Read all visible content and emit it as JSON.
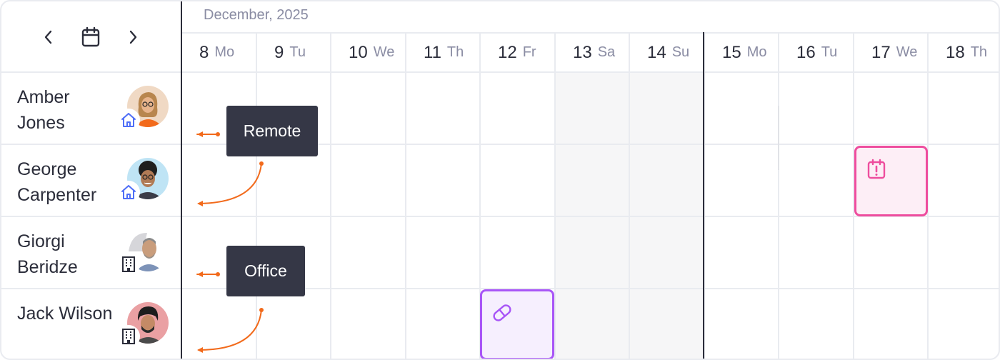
{
  "calendar": {
    "month_label": "December, 2025",
    "days": [
      {
        "num": "8",
        "wd": "Mo",
        "weekend": false
      },
      {
        "num": "9",
        "wd": "Tu",
        "weekend": false
      },
      {
        "num": "10",
        "wd": "We",
        "weekend": false
      },
      {
        "num": "11",
        "wd": "Th",
        "weekend": false
      },
      {
        "num": "12",
        "wd": "Fr",
        "weekend": false
      },
      {
        "num": "13",
        "wd": "Sa",
        "weekend": true
      },
      {
        "num": "14",
        "wd": "Su",
        "weekend": true
      },
      {
        "num": "15",
        "wd": "Mo",
        "weekend": false
      },
      {
        "num": "16",
        "wd": "Tu",
        "weekend": false
      },
      {
        "num": "17",
        "wd": "We",
        "weekend": false
      },
      {
        "num": "18",
        "wd": "Th",
        "weekend": false
      }
    ]
  },
  "nav": {
    "prev_icon": "chevron-left-icon",
    "calendar_icon": "calendar-icon",
    "next_icon": "chevron-right-icon"
  },
  "people": [
    {
      "name": "Amber Jones",
      "location_icon": "home-icon",
      "avatar_color": "#f0d9c4"
    },
    {
      "name": "George Carpenter",
      "location_icon": "home-icon",
      "avatar_color": "#bfe4f5"
    },
    {
      "name": "Giorgi Beridze",
      "location_icon": "building-icon",
      "avatar_color": "#e8e8ea"
    },
    {
      "name": "Jack Wilson",
      "location_icon": "building-icon",
      "avatar_color": "#eaa0a3"
    }
  ],
  "tooltips": {
    "remote_label": "Remote",
    "office_label": "Office"
  },
  "events": [
    {
      "person": "George Carpenter",
      "day": "17",
      "icon": "calendar-alert-icon",
      "color": "#ee4d9e"
    },
    {
      "person": "Jack Wilson",
      "day": "12",
      "icon": "pill-icon",
      "color": "#a855f7"
    }
  ],
  "colors": {
    "arrow": "#f26a1b",
    "home_icon": "#4f6ef7",
    "building_icon": "#2b2d3a",
    "tooltip_bg": "#353746",
    "divider": "#2b2d3a"
  }
}
